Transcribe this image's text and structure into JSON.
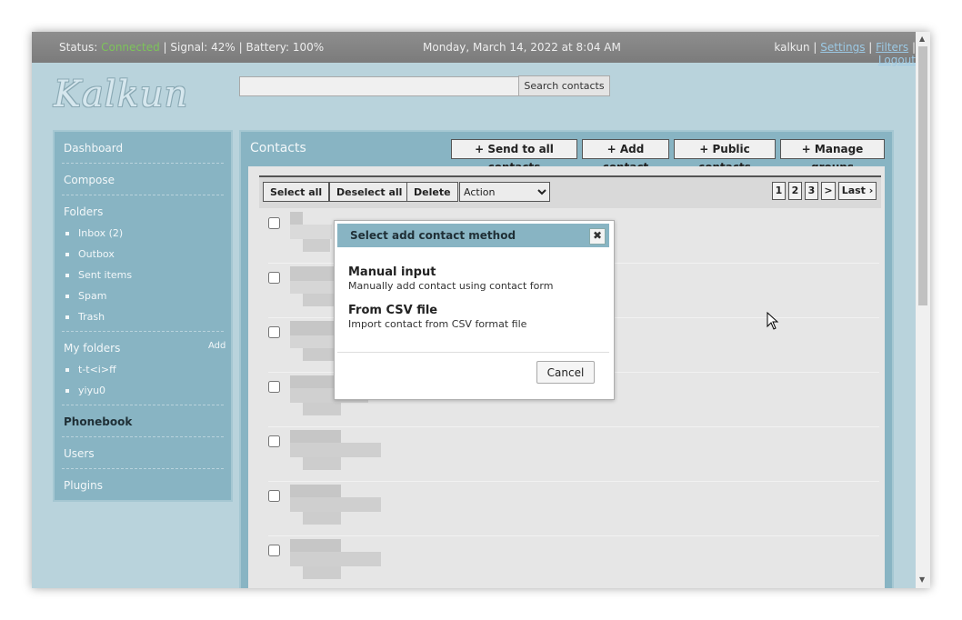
{
  "topbar": {
    "status_label": "Status: ",
    "status_value": "Connected",
    "signal": " | Signal: 42% | Battery: 100%",
    "datetime": "Monday, March 14, 2022 at 8:04 AM",
    "user": "kalkun",
    "settings": "Settings",
    "filters": "Filters",
    "logout": "Logout",
    "sep": " | "
  },
  "logo": "Kalkun",
  "search": {
    "button": "Search contacts",
    "value": ""
  },
  "sidebar": {
    "dashboard": "Dashboard",
    "compose": "Compose",
    "folders": "Folders",
    "folder_items": [
      "Inbox (2)",
      "Outbox",
      "Sent items",
      "Spam",
      "Trash"
    ],
    "my_folders": "My folders",
    "add": "Add",
    "my_folder_items": [
      "t-t<i>ff",
      "yiyu0"
    ],
    "phonebook": "Phonebook",
    "users": "Users",
    "plugins": "Plugins"
  },
  "main": {
    "title": "Contacts",
    "buttons": [
      "+ Send to all contacts",
      "+ Add contact",
      "+ Public contacts",
      "+ Manage groups"
    ],
    "toolbar": {
      "select_all": "Select all",
      "deselect_all": "Deselect all",
      "delete": "Delete",
      "action": "Action"
    },
    "pagination": [
      "1",
      "2",
      "3",
      ">",
      "Last ›"
    ]
  },
  "dialog": {
    "title": "Select add contact method",
    "close": "✖",
    "options": [
      {
        "title": "Manual input",
        "desc": "Manually add contact using contact form"
      },
      {
        "title": "From CSV file",
        "desc": "Import contact from CSV format file"
      }
    ],
    "cancel": "Cancel"
  },
  "colors": {
    "accent": "#88b4c3",
    "background": "#b9d3dc",
    "topbar": "#848484",
    "connected": "#7dc35a"
  }
}
